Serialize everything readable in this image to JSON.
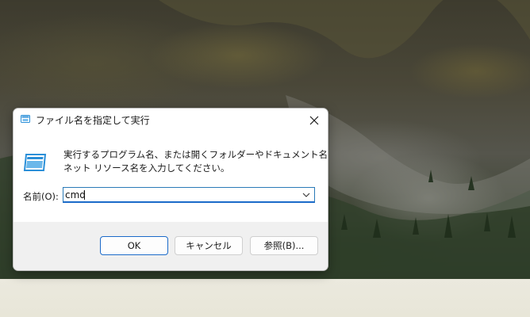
{
  "dialog": {
    "title": "ファイル名を指定して実行",
    "description_line1": "実行するプログラム名、または開くフォルダーやドキュメント名、インター",
    "description_line2": "ネット リソース名を入力してください。",
    "open_label": "名前(O):",
    "open_value": "cmd",
    "buttons": {
      "ok": "OK",
      "cancel": "キャンセル",
      "browse": "参照(B)..."
    }
  },
  "icons": {
    "title_icon": "run-icon",
    "main_icon": "run-icon",
    "close": "close-icon",
    "dropdown": "chevron-down-icon"
  },
  "colors": {
    "accent": "#1b6ac9",
    "icon_blue": "#2b8fd8"
  }
}
